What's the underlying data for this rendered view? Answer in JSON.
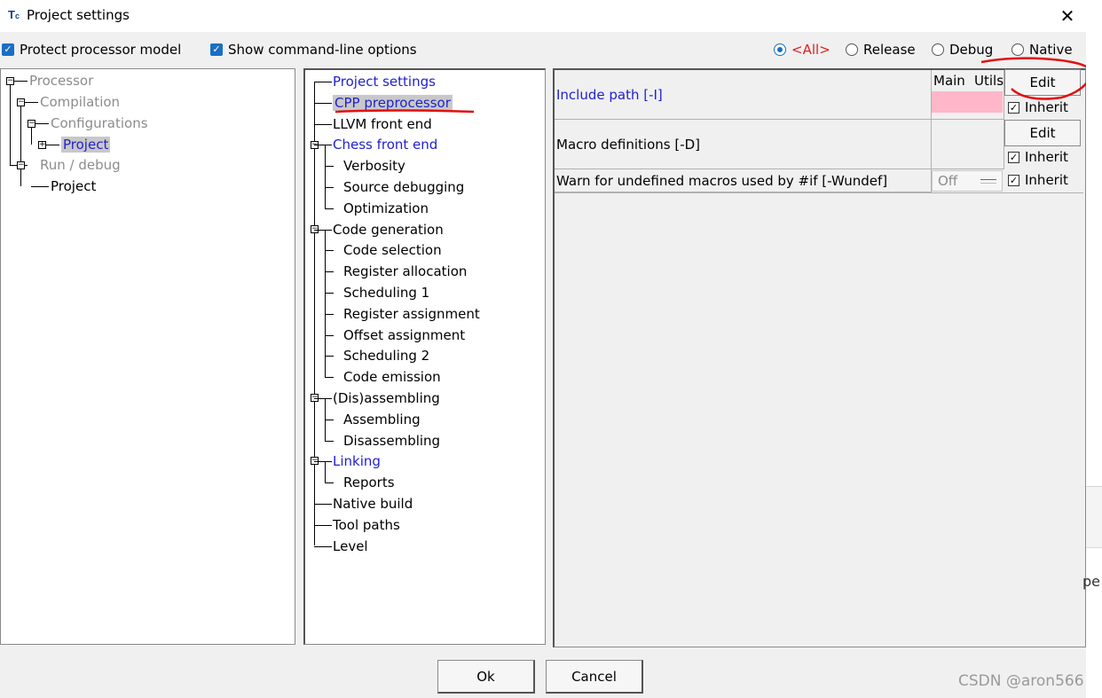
{
  "window": {
    "title": "Project settings",
    "icon": "app-logo-icon",
    "close_glyph": "✕"
  },
  "toolbar": {
    "protect_label": "Protect processor model",
    "show_cmd_label": "Show command-line options",
    "radios": [
      {
        "label": "<All>",
        "selected": true
      },
      {
        "label": "Release",
        "selected": false
      },
      {
        "label": "Debug",
        "selected": false
      },
      {
        "label": "Native",
        "selected": false
      }
    ]
  },
  "proc_tree": {
    "processor": "Processor",
    "compilation": "Compilation",
    "configurations": "Configurations",
    "project_sel": "Project",
    "run_debug": "Run / debug",
    "project": "Project"
  },
  "cat_tree": {
    "items": [
      "Project settings",
      "CPP preprocessor",
      "LLVM front end",
      "Chess front end",
      "Verbosity",
      "Source debugging",
      "Optimization",
      "Code generation",
      "Code selection",
      "Register allocation",
      "Scheduling 1",
      "Register assignment",
      "Offset assignment",
      "Scheduling 2",
      "Code emission",
      "(Dis)assembling",
      "Assembling",
      "Disassembling",
      "Linking",
      "Reports",
      "Native build",
      "Tool paths",
      "Level"
    ]
  },
  "settings": {
    "col_main": "Main",
    "col_utils": "Utils",
    "include_label": "Include path  [-I]",
    "macro_label": "Macro definitions  [-D]",
    "warn_label": "Warn for undefined macros used by #if  [-Wundef]",
    "edit1": "Edit",
    "edit2": "Edit",
    "inherit": "Inherit",
    "off_value": "Off"
  },
  "buttons": {
    "ok": "Ok",
    "cancel": "Cancel"
  },
  "watermark": "CSDN @aron566",
  "right_fragment": "pe",
  "colors": {
    "accent": "#1a6fc4",
    "link_blue": "#1f1fd0",
    "all_red": "#e02020",
    "pink_cell": "#ffb6c8",
    "annotation_red": "#e01010"
  }
}
